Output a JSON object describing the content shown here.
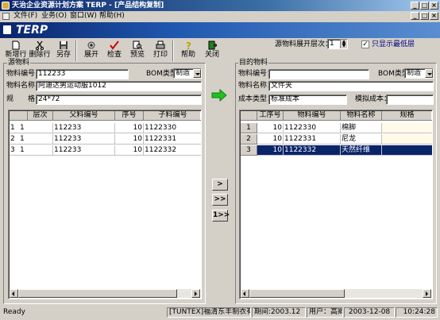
{
  "window": {
    "title": "天治企业资源计划方案 TERP - [产品结构复制]"
  },
  "menu": [
    "文件(F)",
    "业务(O)",
    "窗口(W)",
    "帮助(H)"
  ],
  "logo": "TERP",
  "toolbar": [
    "新增行",
    "删除行",
    "另存",
    "展开",
    "检查",
    "预览",
    "打印",
    "帮助",
    "关闭"
  ],
  "options": {
    "level_label": "源物料展开层次：",
    "level_value": "1",
    "only_lowest_label": "只显示最低层",
    "only_lowest_checked": true
  },
  "source": {
    "legend": "源物料",
    "code_label": "物料编号：",
    "code_value": "112233",
    "bom_label": "BOM类型",
    "bom_value": "制造",
    "name_label": "物料名称：",
    "name_value": "阿迪达男运动服1012",
    "spec_label": "规　　格：",
    "spec_value": "24*72",
    "columns": [
      "层次",
      "父料编号",
      "序号",
      "子料编号"
    ],
    "rows": [
      {
        "rownum": "1",
        "level": "1",
        "parent": "112233",
        "seq": "10",
        "child": "1122330"
      },
      {
        "rownum": "2",
        "level": "1",
        "parent": "112233",
        "seq": "10",
        "child": "1122331"
      },
      {
        "rownum": "3",
        "level": "1",
        "parent": "112233",
        "seq": "10",
        "child": "1122332"
      }
    ]
  },
  "target": {
    "legend": "目的物料",
    "code_label": "物料编号：",
    "code_value": "",
    "bom_label": "BOM类型",
    "bom_value": "制造",
    "name_label": "物料名称：",
    "name_value": "文件夹",
    "cost_label": "成本类型：",
    "cost_value": "标准成本",
    "sim_label": "模拟成本：",
    "sim_value": "",
    "columns": [
      "工序号",
      "物料编号",
      "物料名称",
      "规格"
    ],
    "rows": [
      {
        "rownum": "1",
        "op": "10",
        "code": "1122330",
        "name": "棉脚",
        "spec": ""
      },
      {
        "rownum": "2",
        "op": "10",
        "code": "1122331",
        "name": "尼龙",
        "spec": ""
      },
      {
        "rownum": "3",
        "op": "10",
        "code": "1122332",
        "name": "天然纤维",
        "spec": ""
      }
    ],
    "selected_row": 3
  },
  "move_buttons": [
    ">",
    ">>",
    "1>>"
  ],
  "status": {
    "ready": "Ready",
    "company": "[TUNTEX]福清东丰制衣有限公司",
    "period": "期间:2003.12",
    "user": "用户：高卿",
    "date": "2003-12-08",
    "time": "10:24:28"
  }
}
